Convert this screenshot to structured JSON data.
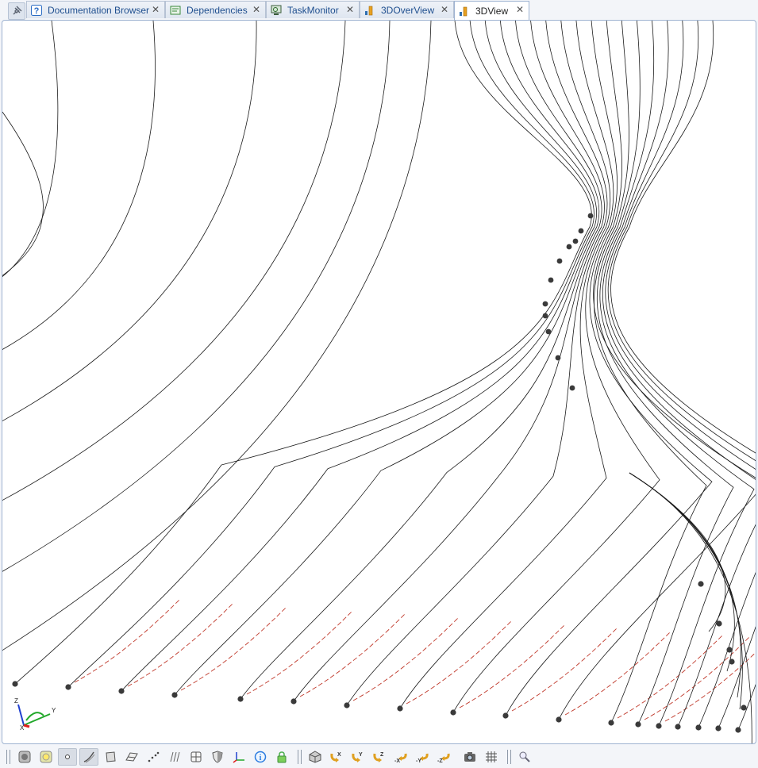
{
  "tabs": [
    {
      "label": "Documentation Browser",
      "icon": "help-icon",
      "active": false
    },
    {
      "label": "Dependencies",
      "icon": "dependencies-icon",
      "active": false
    },
    {
      "label": "TaskMonitor",
      "icon": "task-monitor-icon",
      "active": false
    },
    {
      "label": "3DOverView",
      "icon": "bar-chart-icon",
      "active": false
    },
    {
      "label": "3DView",
      "icon": "bar-chart-icon",
      "active": true
    }
  ],
  "close_glyph": "✕",
  "axes": {
    "z": "Z",
    "y": "Y",
    "x": "X"
  },
  "toolbar": {
    "buttons": [
      "shaded-display-icon",
      "wireframe-display-icon",
      "points-display-icon",
      "curves-display-icon",
      "surface-display-icon",
      "faces-display-icon",
      "dotted-line-icon",
      "parallel-lines-icon",
      "grid-split-icon",
      "shield-icon",
      "axis-triad-icon",
      "info-icon",
      "lock-icon",
      "iso-view-icon",
      "rotate-x-icon",
      "rotate-y-icon",
      "rotate-z-icon",
      "rotate-neg-x-icon",
      "rotate-neg-y-icon",
      "rotate-neg-z-icon",
      "camera-icon",
      "grid-icon",
      "zoom-icon"
    ],
    "axis_labels": {
      "x": "X",
      "y": "Y",
      "z": "Z",
      "nx": "-X",
      "ny": "-Y",
      "nz": "-Z"
    }
  },
  "colors": {
    "curve": "#1a1a1a",
    "highlight": "#c0392b",
    "point": "#3a3a3a",
    "tab_active_border": "#9eb3d1",
    "axis_x": "#e02020",
    "axis_y": "#22a82a",
    "axis_z": "#2040d0"
  }
}
